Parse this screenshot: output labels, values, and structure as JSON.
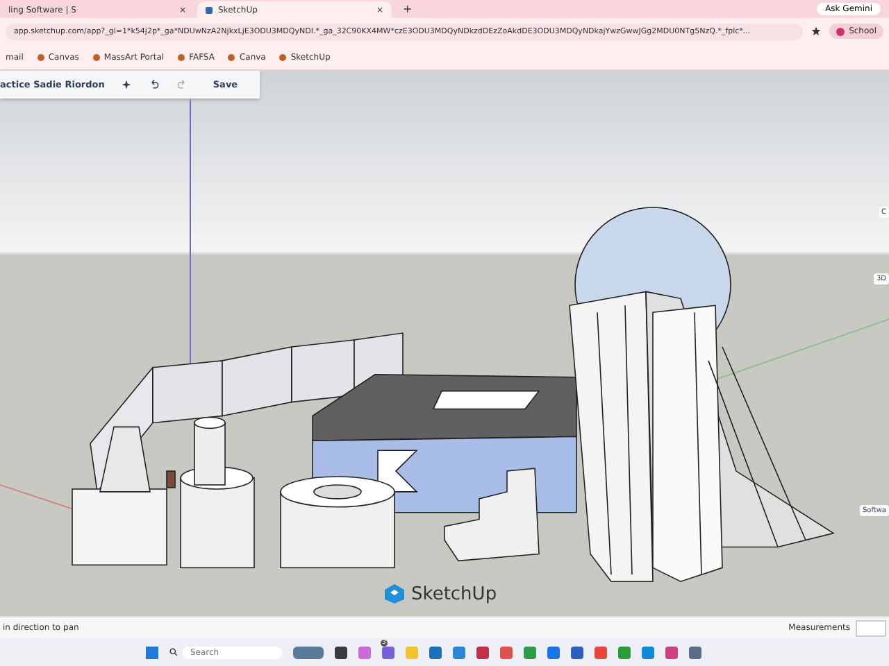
{
  "browser": {
    "tabs": [
      {
        "label": "ling Software | S",
        "close": "×",
        "selected": false
      },
      {
        "label": "SketchUp",
        "close": "×",
        "selected": true
      }
    ],
    "new_tab": "+",
    "ask_button": "Ask Gemini",
    "url": "app.sketchup.com/app?_gl=1*k54j2p*_ga*NDUwNzA2NjkxLjE3ODU3MDQyNDI.*_ga_32C90KX4MW*czE3ODU3MDQyNDkzdDEzZoAkdDE3ODU3MDQyNDkajYwzGwwJGg2MDU0NTg5NzQ.*_fplc*...",
    "profile": "School",
    "bookmarks": [
      "mail",
      "Canvas",
      "MassArt Portal",
      "FAFSA",
      "Canva",
      "SketchUp"
    ]
  },
  "app": {
    "project_title": "actice Sadie Riordon",
    "save": "Save",
    "side_tags": [
      "C",
      "3D",
      "Softwa"
    ],
    "logo": "SketchUp",
    "status": "in direction to pan",
    "measurements_label": "Measurements"
  },
  "taskbar": {
    "search_placeholder": "Search",
    "badge": "3"
  }
}
